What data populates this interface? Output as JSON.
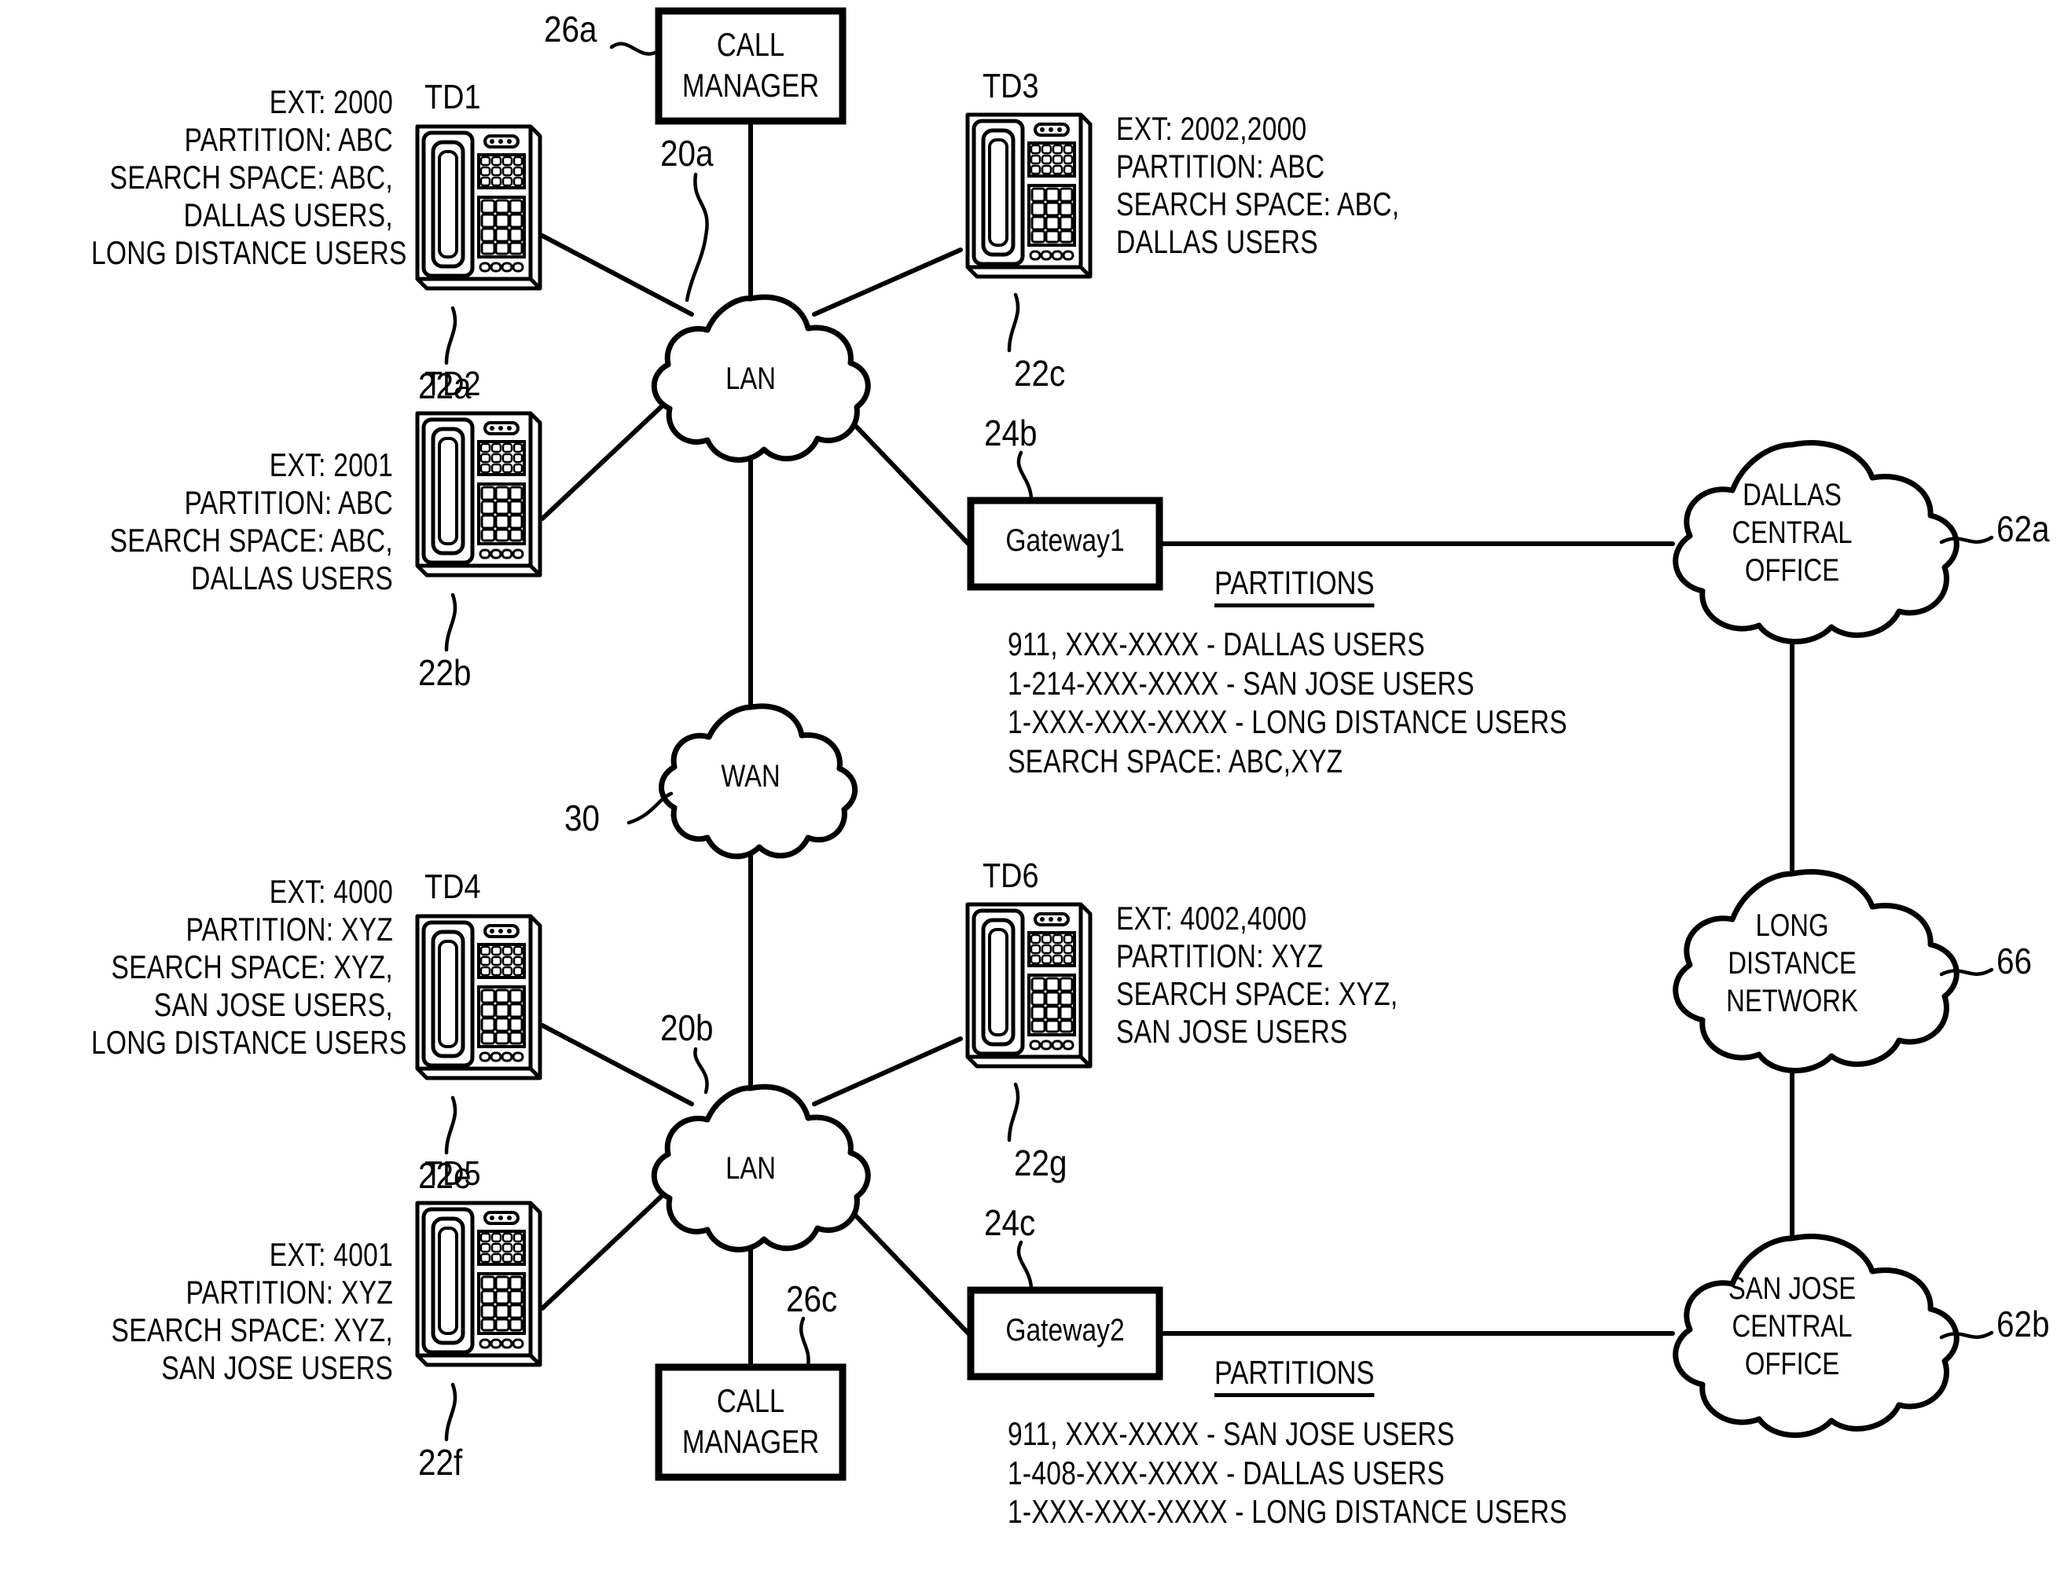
{
  "figure": {
    "title": "Telephony network partitions and calling search space diagram",
    "line_color": "#000000",
    "background": "#ffffff"
  },
  "nodes": {
    "call_manager_top": {
      "label_line1": "CALL",
      "label_line2": "MANAGER",
      "ref": "26a"
    },
    "call_manager_bottom": {
      "label_line1": "CALL",
      "label_line2": "MANAGER",
      "ref": "26c"
    },
    "lan_top": {
      "label": "LAN",
      "ref": "20a"
    },
    "lan_bottom": {
      "label": "LAN",
      "ref": "20b"
    },
    "wan": {
      "label": "WAN",
      "ref": "30"
    },
    "gateway1": {
      "label": "Gateway1",
      "ref": "24b"
    },
    "gateway2": {
      "label": "Gateway2",
      "ref": "24c"
    },
    "dallas_co": {
      "line1": "DALLAS",
      "line2": "CENTRAL",
      "line3": "OFFICE",
      "ref": "62a"
    },
    "long_distance": {
      "line1": "LONG",
      "line2": "DISTANCE",
      "line3": "NETWORK",
      "ref": "66"
    },
    "sanjose_co": {
      "line1": "SAN JOSE",
      "line2": "CENTRAL",
      "line3": "OFFICE",
      "ref": "62b"
    }
  },
  "phones": [
    {
      "id": "td1",
      "name": "TD1",
      "ref": "22a",
      "align": "right",
      "info": [
        "EXT: 2000",
        "PARTITION: ABC",
        "SEARCH SPACE: ABC,",
        "DALLAS USERS,",
        "LONG DISTANCE USERS"
      ]
    },
    {
      "id": "td2",
      "name": "TD2",
      "ref": "22b",
      "align": "right",
      "info": [
        "EXT: 2001",
        "PARTITION: ABC",
        "SEARCH SPACE: ABC,",
        "DALLAS USERS"
      ]
    },
    {
      "id": "td3",
      "name": "TD3",
      "ref": "22c",
      "align": "left",
      "info": [
        "EXT: 2002,2000",
        "PARTITION: ABC",
        "SEARCH SPACE: ABC,",
        "DALLAS USERS"
      ]
    },
    {
      "id": "td4",
      "name": "TD4",
      "ref": "22e",
      "align": "right",
      "info": [
        "EXT: 4000",
        "PARTITION: XYZ",
        "SEARCH SPACE: XYZ,",
        "SAN JOSE USERS,",
        "LONG DISTANCE USERS"
      ]
    },
    {
      "id": "td5",
      "name": "TD5",
      "ref": "22f",
      "align": "right",
      "info": [
        "EXT: 4001",
        "PARTITION: XYZ",
        "SEARCH SPACE: XYZ,",
        "SAN JOSE USERS"
      ]
    },
    {
      "id": "td6",
      "name": "TD6",
      "ref": "22g",
      "align": "left",
      "info": [
        "EXT: 4002,4000",
        "PARTITION: XYZ",
        "SEARCH SPACE: XYZ,",
        "SAN JOSE USERS"
      ]
    }
  ],
  "partition_tables": [
    {
      "id": "gateway1-partitions",
      "title": "PARTITIONS",
      "rows": [
        "911, XXX-XXXX - DALLAS USERS",
        "1-214-XXX-XXXX - SAN JOSE USERS",
        "1-XXX-XXX-XXXX - LONG DISTANCE USERS",
        "SEARCH SPACE: ABC,XYZ"
      ]
    },
    {
      "id": "gateway2-partitions",
      "title": "PARTITIONS",
      "rows": [
        "911, XXX-XXXX - SAN JOSE USERS",
        "1-408-XXX-XXXX - DALLAS USERS",
        "1-XXX-XXX-XXXX - LONG DISTANCE USERS"
      ]
    }
  ]
}
